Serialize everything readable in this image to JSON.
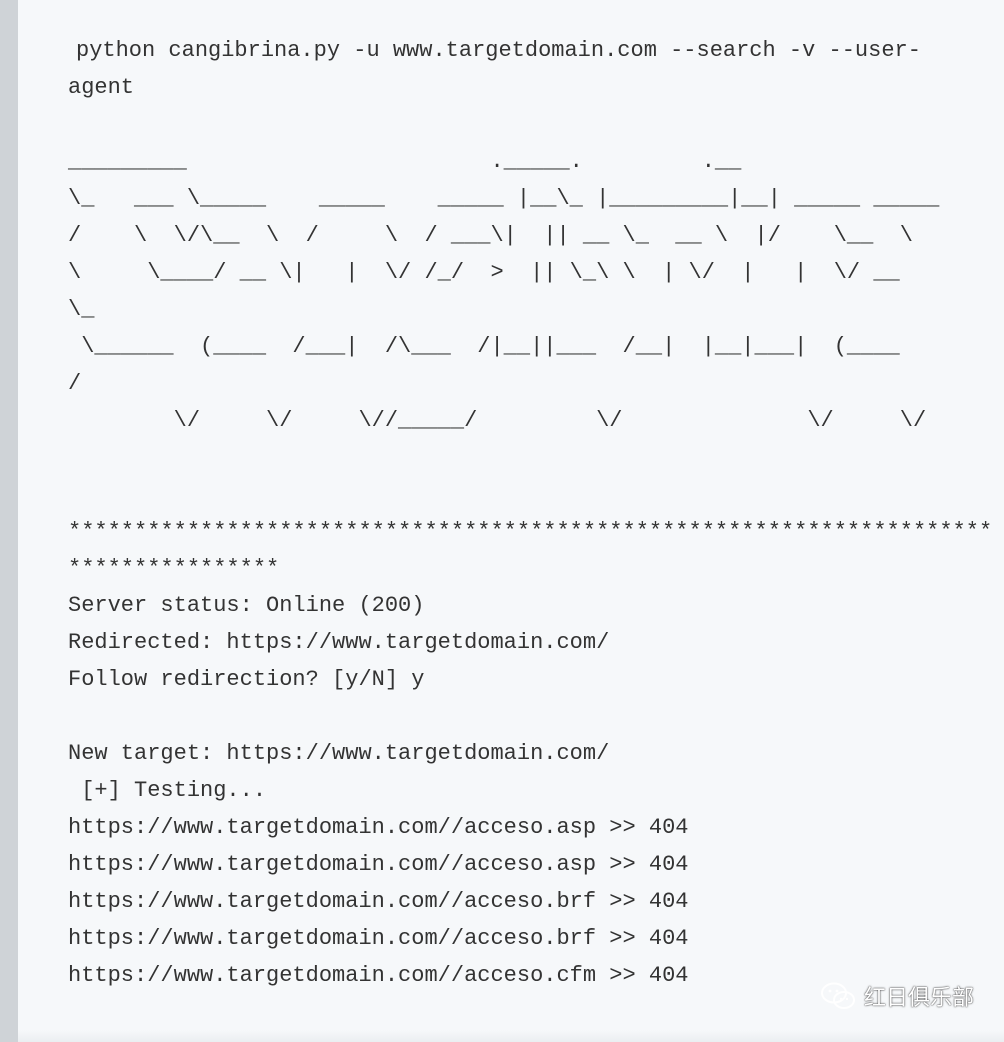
{
  "command": {
    "line1": "python cangibrina.py -u www.targetdomain.com --search -v --user-",
    "line2": "agent"
  },
  "banner": [
    "_________                       ._____.         .__",
    "\\_   ___ \\_____    _____    _____ |__\\_ |_________|__| _____ _____",
    "/    \\  \\/\\__  \\  /     \\  / ___\\|  || __ \\_  __ \\  |/    \\__  \\",
    "\\     \\____/ __ \\|   |  \\/ /_/  >  || \\_\\ \\  | \\/  |   |  \\/ __",
    "\\_",
    " \\______  (____  /___|  /\\___  /|__||___  /__|  |__|___|  (____",
    "/",
    "        \\/     \\/     \\//_____/         \\/              \\/     \\/"
  ],
  "divider": {
    "line1": "**********************************************************************",
    "line2": "****************"
  },
  "output": {
    "server_status": "Server status: Online (200)",
    "redirected": "Redirected: https://www.targetdomain.com/",
    "follow_prompt": "Follow redirection? [y/N] y",
    "new_target": "New target: https://www.targetdomain.com/",
    "testing": " [+] Testing...",
    "results": [
      "https://www.targetdomain.com//acceso.asp >> 404",
      "https://www.targetdomain.com//acceso.asp >> 404",
      "https://www.targetdomain.com//acceso.brf >> 404",
      "https://www.targetdomain.com//acceso.brf >> 404",
      "https://www.targetdomain.com//acceso.cfm >> 404"
    ]
  },
  "watermark": {
    "text": "红日俱乐部",
    "icon": "wechat-logo-icon"
  }
}
